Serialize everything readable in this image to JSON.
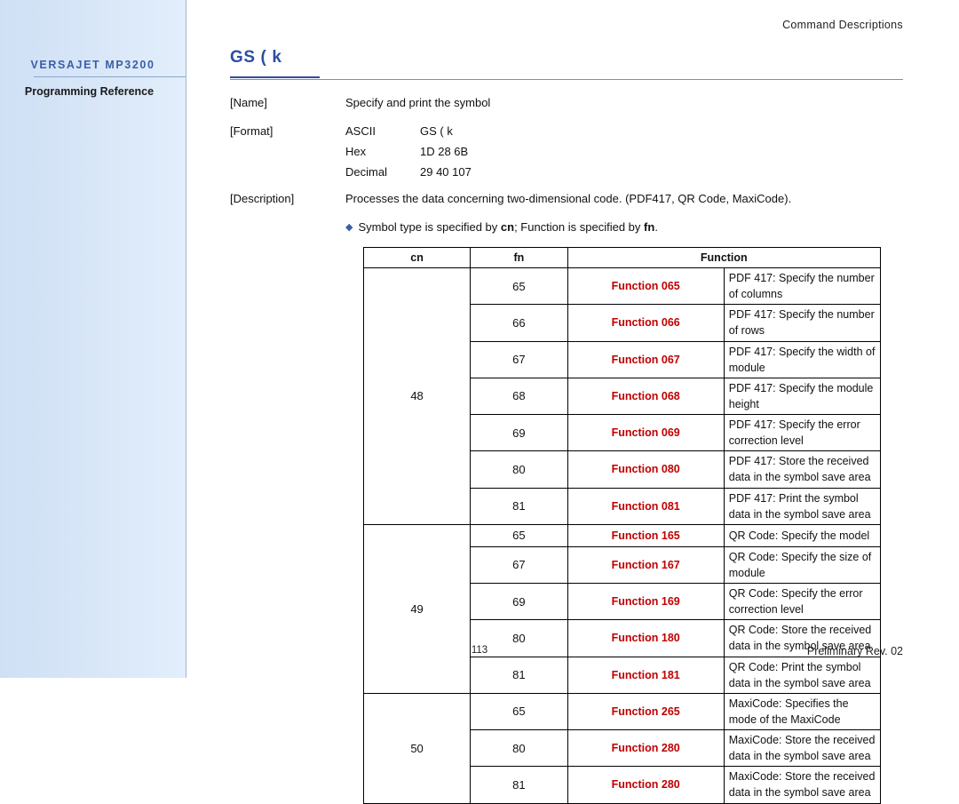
{
  "sidebar": {
    "brand": "VERSAJET MP3200",
    "subtitle": "Programming Reference"
  },
  "header": {
    "section": "Command  Descriptions",
    "command_title": "GS ( k"
  },
  "body": {
    "name_label": "[Name]",
    "name_value": "Specify and print the symbol",
    "format_label": "[Format]",
    "format_rows": [
      {
        "type": "ASCII",
        "value": "GS ( k"
      },
      {
        "type": "Hex",
        "value": "1D 28 6B"
      },
      {
        "type": "Decimal",
        "value": "29 40 107"
      }
    ],
    "description_label": "[Description]",
    "description_value": "Processes the data concerning two-dimensional code. (PDF417, QR Code, MaxiCode).",
    "bullet_prefix": "Symbol type is specified by",
    "bullet_cn": "cn",
    "bullet_middle": "; Function is specified by",
    "bullet_fn": "fn",
    "bullet_suffix": "."
  },
  "table": {
    "headers": [
      "cn",
      "fn",
      "Function"
    ],
    "groups": [
      {
        "cn": "48",
        "rows": [
          {
            "fn": "65",
            "function": "Function 065",
            "description": "PDF 417: Specify the number of columns",
            "tall": false
          },
          {
            "fn": "66",
            "function": "Function 066",
            "description": "PDF 417: Specify the number of rows",
            "tall": false
          },
          {
            "fn": "67",
            "function": "Function 067",
            "description": "PDF 417: Specify the width of module",
            "tall": false
          },
          {
            "fn": "68",
            "function": "Function 068",
            "description": "PDF 417: Specify the module height",
            "tall": false
          },
          {
            "fn": "69",
            "function": "Function 069",
            "description": "PDF 417: Specify the error correction level",
            "tall": false
          },
          {
            "fn": "80",
            "function": "Function 080",
            "description": "PDF 417: Store the received data in the symbol save area",
            "tall": true
          },
          {
            "fn": "81",
            "function": "Function 081",
            "description": "PDF 417: Print the symbol data in the symbol save area",
            "tall": false
          }
        ]
      },
      {
        "cn": "49",
        "rows": [
          {
            "fn": "65",
            "function": "Function 165",
            "description": "QR Code: Specify the model",
            "tall": false
          },
          {
            "fn": "67",
            "function": "Function 167",
            "description": "QR Code: Specify the size of module",
            "tall": false
          },
          {
            "fn": "69",
            "function": "Function 169",
            "description": "QR Code: Specify the error correction level",
            "tall": false
          },
          {
            "fn": "80",
            "function": "Function 180",
            "description": "QR Code: Store the received data in the symbol save area",
            "tall": true
          },
          {
            "fn": "81",
            "function": "Function 181",
            "description": "QR Code: Print the symbol data in the symbol save area",
            "tall": true
          }
        ]
      },
      {
        "cn": "50",
        "rows": [
          {
            "fn": "65",
            "function": "Function 265",
            "description": "MaxiCode: Specifies the mode of the MaxiCode",
            "tall": false
          },
          {
            "fn": "80",
            "function": "Function 280",
            "description": "MaxiCode: Store the received data in the symbol save area",
            "tall": true
          },
          {
            "fn": "81",
            "function": "Function 280",
            "description": "MaxiCode: Store the received data in the symbol save area",
            "tall": true
          }
        ]
      }
    ]
  },
  "footer": {
    "page_number": "113",
    "revision": "Preliminary Rev. 02"
  },
  "colors": {
    "title_blue": "#2b4ea2",
    "function_red": "#c00000",
    "sidebar_blue": "#d6e5f7"
  }
}
